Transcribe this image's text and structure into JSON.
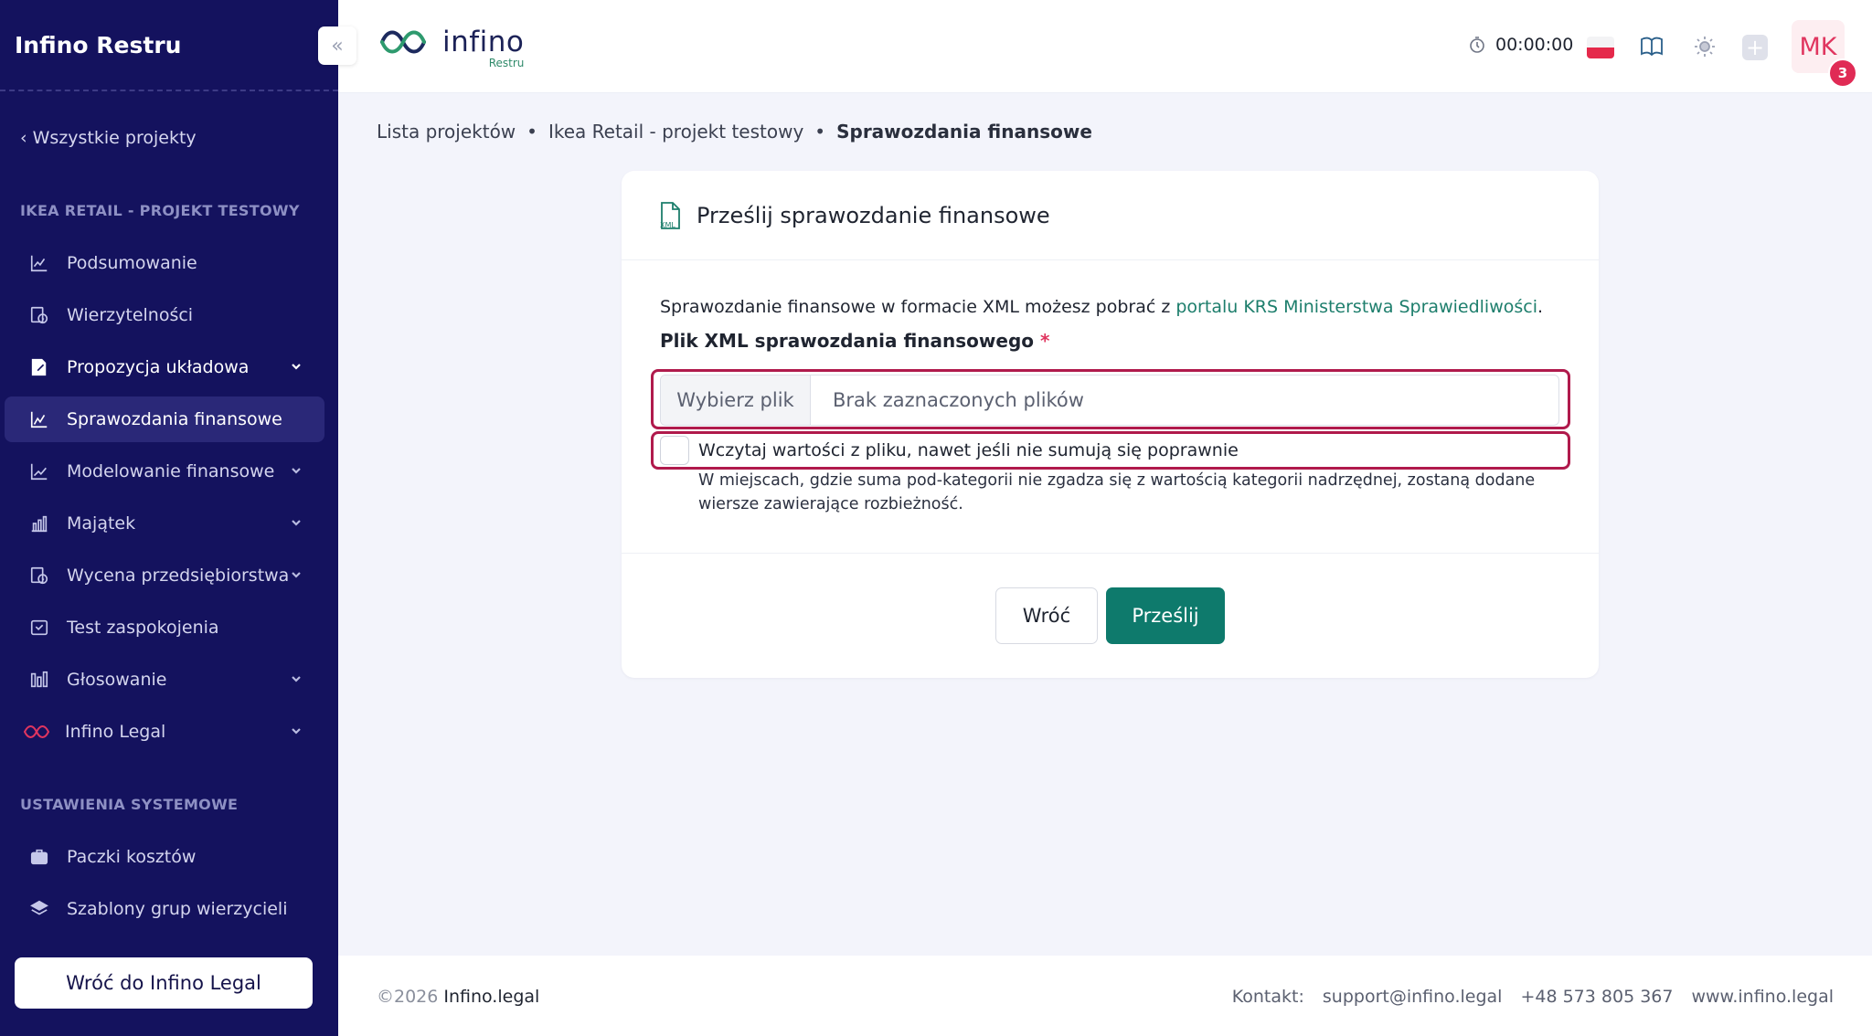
{
  "sidebar": {
    "brand": "Infino Restru",
    "back_link": "‹ Wszystkie projekty",
    "project_section": "IKEA RETAIL - PROJEKT TESTOWY",
    "items": [
      {
        "label": "Podsumowanie",
        "icon": "chart-line-icon"
      },
      {
        "label": "Wierzytelności",
        "icon": "receipt-clock-icon"
      },
      {
        "label": "Propozycja układowa",
        "icon": "document-edit-icon"
      },
      {
        "label": "Sprawozdania finansowe",
        "icon": "chart-area-icon"
      },
      {
        "label": "Modelowanie finansowe",
        "icon": "chart-trend-icon"
      },
      {
        "label": "Majątek",
        "icon": "building-chart-icon"
      },
      {
        "label": "Wycena przedsiębiorstwa",
        "icon": "valuation-icon"
      },
      {
        "label": "Test zaspokojenia",
        "icon": "inbox-check-icon"
      },
      {
        "label": "Głosowanie",
        "icon": "voting-icon"
      },
      {
        "label": "Infino Legal",
        "icon": "infinity-logo-icon"
      }
    ],
    "system_section": "USTAWIENIA SYSTEMOWE",
    "system_items": [
      {
        "label": "Paczki kosztów",
        "icon": "package-icon"
      },
      {
        "label": "Szablony grup wierzycieli",
        "icon": "layers-icon"
      }
    ],
    "return_button": "Wróć do Infino Legal"
  },
  "header": {
    "logo_text": "infino",
    "logo_sub": "Restru",
    "timer": "00:00:00",
    "language": "PL",
    "avatar_initials": "MK",
    "notifications_count": "3"
  },
  "breadcrumb": {
    "items": [
      "Lista projektów",
      "Ikea Retail - projekt testowy"
    ],
    "current": "Sprawozdania finansowe",
    "separator": "•"
  },
  "card": {
    "title": "Prześlij sprawozdanie finansowe",
    "intro_text": "Sprawozdanie finansowe w formacie XML możesz pobrać z ",
    "intro_link": "portalu KRS Ministerstwa Sprawiedliwości",
    "intro_end": ".",
    "field_label": "Plik XML sprawozdania finansowego",
    "required_mark": "*",
    "file_button": "Wybierz plik",
    "file_placeholder": "Brak zaznaczonych plików",
    "checkbox_label": "Wczytaj wartości z pliku, nawet jeśli nie sumują się poprawnie",
    "help_text": "W miejscach, gdzie suma pod-kategorii nie zgadza się z wartością kategorii nadrzędnej, zostaną dodane wiersze zawierające rozbieżność.",
    "back_button": "Wróć",
    "submit_button": "Prześlij"
  },
  "footer": {
    "copyright": "©2026",
    "brand": "Infino.legal",
    "contact_label": "Kontakt:",
    "email": "support@infino.legal",
    "phone": "+48 573 805 367",
    "website": "www.infino.legal"
  },
  "colors": {
    "sidebar_bg": "#14125e",
    "accent_green": "#0e7a6c",
    "highlight_red": "#b01a4c",
    "badge_red": "#e02b55"
  }
}
